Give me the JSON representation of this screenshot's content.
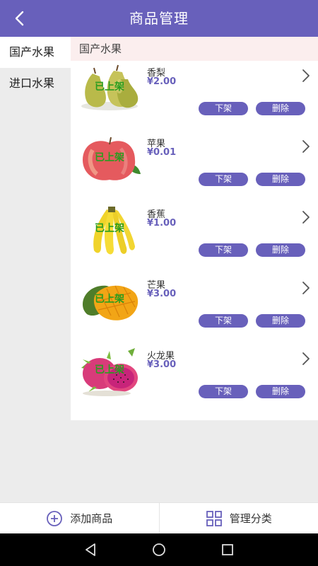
{
  "header": {
    "title": "商品管理",
    "back_icon": "chevron-left-icon"
  },
  "sidebar": {
    "items": [
      {
        "label": "国产水果"
      },
      {
        "label": "进口水果"
      }
    ]
  },
  "section": {
    "title": "国产水果"
  },
  "products": [
    {
      "name": "香梨",
      "price": "¥2.00",
      "status": "已上架",
      "off_label": "下架",
      "delete_label": "删除",
      "image_icon": "pear-image"
    },
    {
      "name": "苹果",
      "price": "¥0.01",
      "status": "已上架",
      "off_label": "下架",
      "delete_label": "删除",
      "image_icon": "apple-image"
    },
    {
      "name": "香蕉",
      "price": "¥1.00",
      "status": "已上架",
      "off_label": "下架",
      "delete_label": "删除",
      "image_icon": "banana-image"
    },
    {
      "name": "芒果",
      "price": "¥3.00",
      "status": "已上架",
      "off_label": "下架",
      "delete_label": "删除",
      "image_icon": "mango-image"
    },
    {
      "name": "火龙果",
      "price": "¥3.00",
      "status": "已上架",
      "off_label": "下架",
      "delete_label": "删除",
      "image_icon": "dragonfruit-image"
    }
  ],
  "bottom_bar": {
    "add_label": "添加商品",
    "manage_label": "管理分类"
  },
  "colors": {
    "accent": "#6860bb",
    "status_green": "#2a9d1f",
    "section_bg": "#fbeeee"
  }
}
